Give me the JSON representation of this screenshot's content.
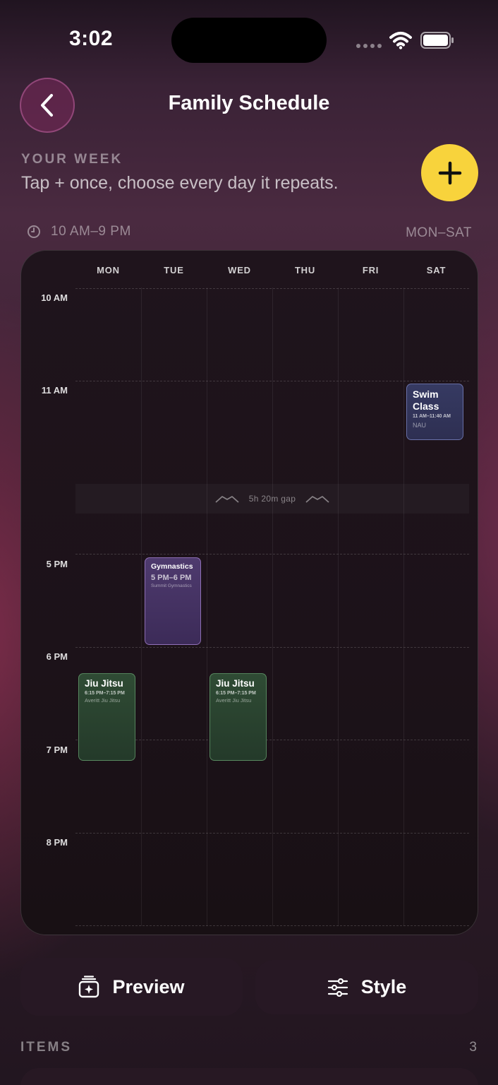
{
  "status": {
    "time": "3:02"
  },
  "header": {
    "title": "Family Schedule"
  },
  "intro": {
    "label": "YOUR WEEK",
    "subtitle": "Tap + once, choose every day it repeats."
  },
  "range": {
    "hours": "10 AM–9 PM",
    "days": "MON–SAT"
  },
  "calendar": {
    "days": [
      "MON",
      "TUE",
      "WED",
      "THU",
      "FRI",
      "SAT"
    ],
    "hours": [
      "10 AM",
      "11 AM",
      "5 PM",
      "6 PM",
      "7 PM",
      "8 PM"
    ],
    "gap": "5h 20m gap",
    "events": [
      {
        "title": "Swim Class",
        "time": "11 AM–11:40 AM",
        "place": "NAU",
        "day": "SAT"
      },
      {
        "title": "Gymnastics",
        "time": "5 PM–6 PM",
        "place": "Summit Gymnastics",
        "day": "TUE"
      },
      {
        "title": "Jiu Jitsu",
        "time": "6:15 PM–7:15 PM",
        "place": "Averitt Jiu Jitsu",
        "day": "MON"
      },
      {
        "title": "Jiu Jitsu",
        "time": "6:15 PM–7:15 PM",
        "place": "Averitt Jiu Jitsu",
        "day": "WED"
      }
    ]
  },
  "actions": {
    "preview": "Preview",
    "style": "Style"
  },
  "items": {
    "label": "ITEMS",
    "count": "3"
  },
  "colors": {
    "accent": "#f8d33c",
    "swim": "#363a62",
    "gymnastics": "#4e3a6e",
    "jiujitsu": "#2f4b34"
  }
}
